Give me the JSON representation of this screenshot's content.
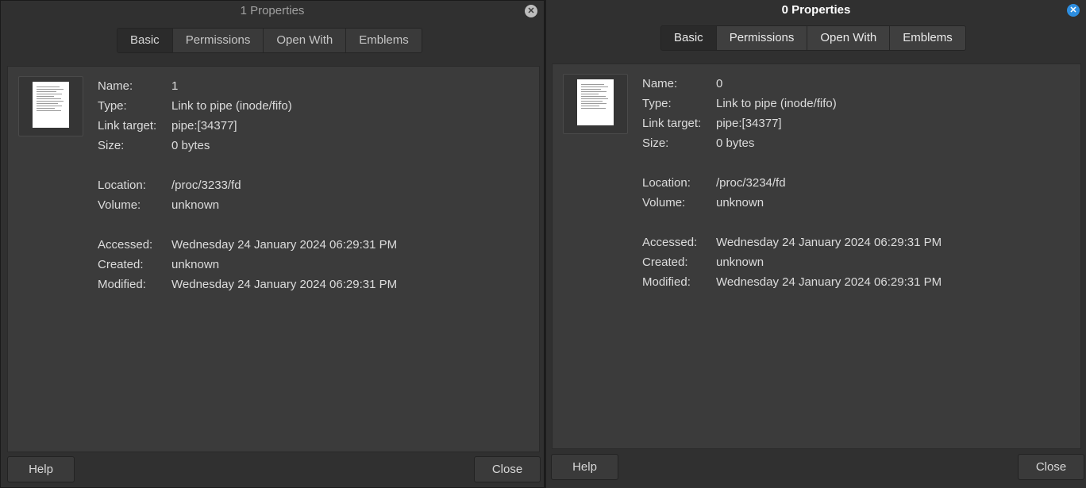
{
  "left_window": {
    "title": "1 Properties",
    "close_glyph": "✕",
    "tabs": [
      {
        "label": "Basic",
        "active": true
      },
      {
        "label": "Permissions",
        "active": false
      },
      {
        "label": "Open With",
        "active": false
      },
      {
        "label": "Emblems",
        "active": false
      }
    ],
    "file_icon": "text-document-icon",
    "properties": {
      "name_label": "Name:",
      "name": "1",
      "type_label": "Type:",
      "type": "Link to pipe (inode/fifo)",
      "link_target_label": "Link target:",
      "link_target": "pipe:[34377]",
      "size_label": "Size:",
      "size": "0 bytes",
      "location_label": "Location:",
      "location": "/proc/3233/fd",
      "volume_label": "Volume:",
      "volume": "unknown",
      "accessed_label": "Accessed:",
      "accessed": "Wednesday 24 January 2024 06:29:31 PM",
      "created_label": "Created:",
      "created": "unknown",
      "modified_label": "Modified:",
      "modified": "Wednesday 24 January 2024 06:29:31 PM"
    },
    "help_label": "Help",
    "close_label": "Close"
  },
  "right_window": {
    "title": "0 Properties",
    "close_glyph": "✕",
    "tabs": [
      {
        "label": "Basic",
        "active": true
      },
      {
        "label": "Permissions",
        "active": false
      },
      {
        "label": "Open With",
        "active": false
      },
      {
        "label": "Emblems",
        "active": false
      }
    ],
    "file_icon": "text-document-icon",
    "properties": {
      "name_label": "Name:",
      "name": "0",
      "type_label": "Type:",
      "type": "Link to pipe (inode/fifo)",
      "link_target_label": "Link target:",
      "link_target": "pipe:[34377]",
      "size_label": "Size:",
      "size": "0 bytes",
      "location_label": "Location:",
      "location": "/proc/3234/fd",
      "volume_label": "Volume:",
      "volume": "unknown",
      "accessed_label": "Accessed:",
      "accessed": "Wednesday 24 January 2024 06:29:31 PM",
      "created_label": "Created:",
      "created": "unknown",
      "modified_label": "Modified:",
      "modified": "Wednesday 24 January 2024 06:29:31 PM"
    },
    "help_label": "Help",
    "close_label": "Close"
  },
  "colors": {
    "window_bg": "#303030",
    "content_bg": "#3b3b3b",
    "active_close_button": "#2d8ee0"
  }
}
